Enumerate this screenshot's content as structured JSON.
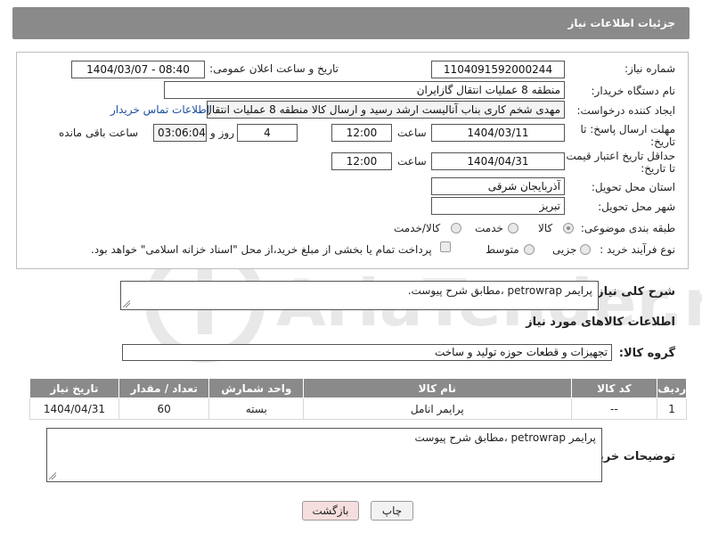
{
  "header": {
    "title": "جزئیات اطلاعات نیاز"
  },
  "form": {
    "need_number": {
      "label": "شماره نیاز:",
      "value": "1104091592000244"
    },
    "announce_datetime": {
      "label": "تاریخ و ساعت اعلان عمومی:",
      "value": "1404/03/07 - 08:40"
    },
    "buyer_org": {
      "label": "نام دستگاه خریدار:",
      "value": "منطقه 8 عملیات انتقال گازایران"
    },
    "requester": {
      "label": "ایجاد کننده درخواست:",
      "value": "مهدی شخم کاری بناب آنالیست ارشد رسید و ارسال کالا منطقه 8 عملیات انتقال",
      "contact_link": "اطلاعات تماس خریدار"
    },
    "reply_deadline": {
      "label_line1": "مهلت ارسال پاسخ: تا",
      "label_line2": "تاریخ:",
      "date": "1404/03/11",
      "time_label": "ساعت",
      "time": "12:00",
      "days": "4",
      "days_label": "روز و",
      "remaining": "03:06:04",
      "remaining_label": "ساعت باقی مانده"
    },
    "price_validity": {
      "label_line1": "حداقل تاریخ اعتبار قیمت:",
      "label_line2": "تا تاریخ:",
      "date": "1404/04/31",
      "time_label": "ساعت",
      "time": "12:00"
    },
    "delivery_province": {
      "label": "استان محل تحویل:",
      "value": "آذربایجان شرقی"
    },
    "delivery_city": {
      "label": "شهر محل تحویل:",
      "value": "تبریز"
    },
    "category": {
      "label": "طبقه بندی موضوعی:",
      "options": [
        "کالا",
        "خدمت",
        "کالا/خدمت"
      ],
      "selected": "کالا"
    },
    "purchase_type": {
      "label": "نوع فرآیند خرید :",
      "options": [
        "جزیی",
        "متوسط"
      ],
      "note": "پرداخت تمام یا بخشی از مبلغ خرید،از محل \"اسناد خزانه اسلامی\" خواهد بود."
    }
  },
  "description": {
    "label": "شرح کلی نیاز:",
    "value": "پرایمر petrowrap ،مطابق شرح پیوست."
  },
  "goods_section": {
    "title": "اطلاعات کالاهای مورد نیاز",
    "group_label": "گروه کالا:",
    "group_value": "تجهیزات و قطعات حوزه تولید و ساخت"
  },
  "table": {
    "headers": [
      "ردیف",
      "کد کالا",
      "نام کالا",
      "واحد شمارش",
      "تعداد / مقدار",
      "تاریخ نیاز"
    ],
    "rows": [
      [
        "1",
        "--",
        "پرایمر انامل",
        "بسته",
        "60",
        "1404/04/31"
      ]
    ]
  },
  "buyer_notes": {
    "label": "توضیحات خریدار:",
    "value": "پرایمر petrowrap ،مطابق شرح پیوست"
  },
  "buttons": {
    "print": "چاپ",
    "back": "بازگشت"
  },
  "watermark": {
    "text": "AriaTender.neT"
  },
  "colors": {
    "header_bg": "#8a8a8a",
    "link": "#1a4fa0",
    "back_button_bg": "#f6dede",
    "print_button_bg": "#f2f2f2"
  }
}
